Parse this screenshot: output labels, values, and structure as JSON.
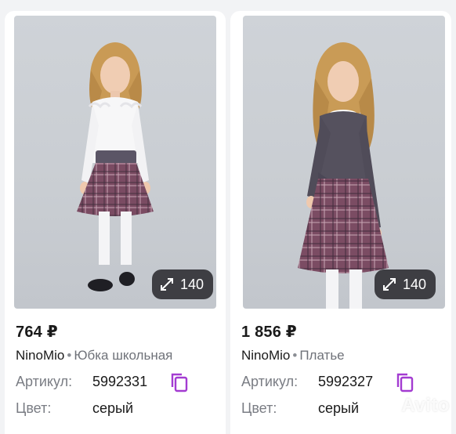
{
  "listings": [
    {
      "price": "764 ₽",
      "brand": "NinoMio",
      "separator": "•",
      "kind": "Юбка школьная",
      "sku_label": "Артикул:",
      "sku_value": "5992331",
      "color_label": "Цвет:",
      "color_value": "серый",
      "photo_count": "140"
    },
    {
      "price": "1 856 ₽",
      "brand": "NinoMio",
      "separator": "•",
      "kind": "Платье",
      "sku_label": "Артикул:",
      "sku_value": "5992327",
      "color_label": "Цвет:",
      "color_value": "серый",
      "photo_count": "140"
    }
  ],
  "watermark": "Avito",
  "colors": {
    "accent_copy": "#a33bd1",
    "badge_bg": "#28282c",
    "page_bg": "#f2f3f5"
  },
  "icons": [
    "expand-icon",
    "copy-icon",
    "avito-logo"
  ]
}
